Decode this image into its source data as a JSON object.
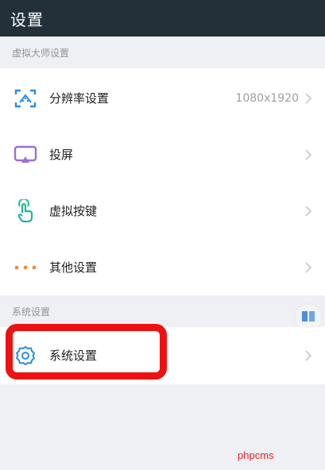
{
  "header": {
    "title": "设置"
  },
  "sections": {
    "virtual_master": "虚拟大师设置",
    "system": "系统设置"
  },
  "rows": {
    "resolution": {
      "label": "分辨率设置",
      "value": "1080x1920",
      "icon": "resolution-scan-icon"
    },
    "cast": {
      "label": "投屏",
      "icon": "cast-screen-icon"
    },
    "virtual_keys": {
      "label": "虚拟按键",
      "icon": "touch-hand-icon"
    },
    "other": {
      "label": "其他设置",
      "icon": "more-dots-icon"
    },
    "system_settings": {
      "label": "系统设置",
      "icon": "gear-icon"
    }
  },
  "watermark": "phpcms",
  "colors": {
    "topbar": "#23303a",
    "accent_blue": "#2b8de0",
    "accent_teal": "#23b39a",
    "accent_purple": "#9b6fd6",
    "accent_orange": "#f08a3c",
    "highlight_red": "#ee1111"
  }
}
